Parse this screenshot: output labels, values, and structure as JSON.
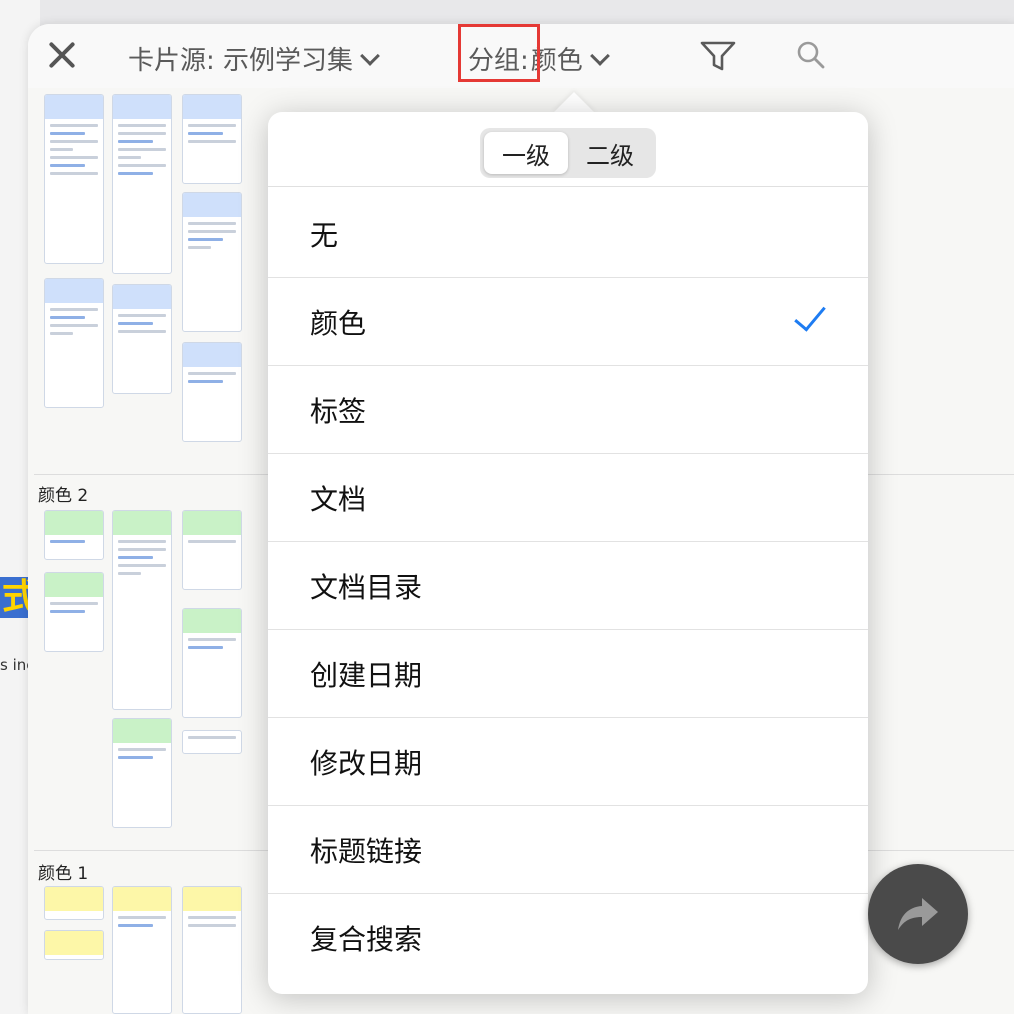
{
  "toolbar": {
    "card_source_label": "卡片源: 示例学习集",
    "group_label": "分组:",
    "group_value": "颜色"
  },
  "canvas": {
    "sections": [
      "颜色 2",
      "颜色 1"
    ]
  },
  "popover": {
    "segments": [
      "一级",
      "二级"
    ],
    "active_segment": "一级",
    "items": [
      "无",
      "颜色",
      "标签",
      "文档",
      "文档目录",
      "创建日期",
      "修改日期",
      "标题链接",
      "复合搜索"
    ],
    "selected_item": "颜色"
  },
  "background": {
    "fragments": [
      "式",
      "s inec"
    ]
  },
  "colors": {
    "accent": "#1e7cf2",
    "highlight_box": "#e53935",
    "fab": "#4a4a4a"
  },
  "icons": {
    "close": "close-icon",
    "dropdown": "chevron-down-icon",
    "filter": "filter-icon",
    "search": "search-icon",
    "check": "checkmark-icon",
    "share": "share-arrow-icon"
  }
}
